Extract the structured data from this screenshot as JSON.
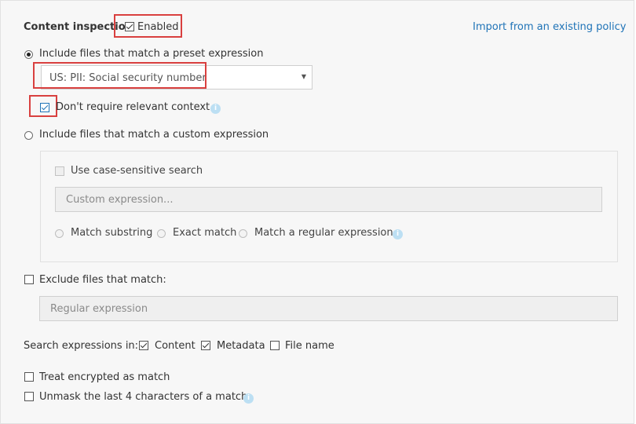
{
  "content_inspection": {
    "label": "Content inspection",
    "enabled_label": "Enabled",
    "enabled": true,
    "import_link": "Import from an existing policy"
  },
  "preset": {
    "radio_label": "Include files that match a preset expression",
    "selected": true,
    "dropdown_value": "US: PII: Social security number",
    "no_context_label": "Don't require relevant context",
    "no_context_checked": true
  },
  "custom": {
    "radio_label": "Include files that match a custom expression",
    "selected": false,
    "case_sensitive_label": "Use case-sensitive search",
    "expression_placeholder": "Custom expression...",
    "match_options": [
      "Match substring",
      "Exact match",
      "Match a regular expression"
    ]
  },
  "exclude": {
    "label": "Exclude files that match:",
    "placeholder": "Regular expression"
  },
  "search_in": {
    "label": "Search expressions in:",
    "options": [
      {
        "label": "Content",
        "checked": true
      },
      {
        "label": "Metadata",
        "checked": true
      },
      {
        "label": "File name",
        "checked": false
      }
    ]
  },
  "treat_encrypted_label": "Treat encrypted as match",
  "unmask_label": "Unmask the last 4 characters of a match",
  "colors": {
    "link": "#1f73b7",
    "highlight": "#d9403f",
    "info_icon": "#bcdff3",
    "panel_bg": "#f7f7f7"
  }
}
